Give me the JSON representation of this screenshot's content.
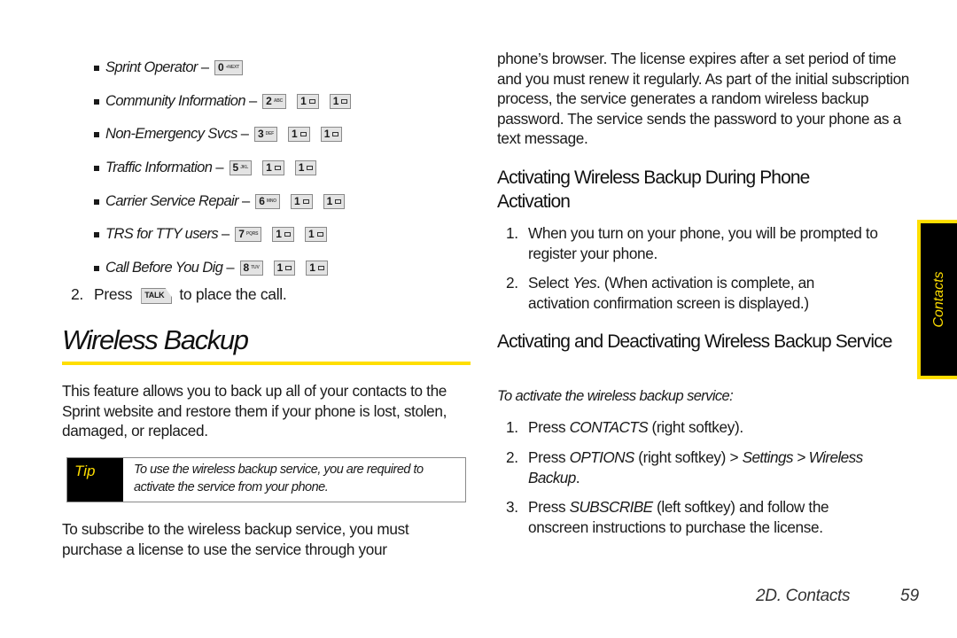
{
  "key_sequences": [
    {
      "label": "Sprint Operator",
      "keys": [
        {
          "num": "0",
          "sub": "+NEXT"
        }
      ]
    },
    {
      "label": "Community Information",
      "keys": [
        {
          "num": "2",
          "sub": "ABC"
        },
        {
          "num": "1",
          "sub": "mail"
        },
        {
          "num": "1",
          "sub": "mail"
        }
      ]
    },
    {
      "label": "Non-Emergency Svcs",
      "keys": [
        {
          "num": "3",
          "sub": "DEF"
        },
        {
          "num": "1",
          "sub": "mail"
        },
        {
          "num": "1",
          "sub": "mail"
        }
      ]
    },
    {
      "label": "Traffic Information",
      "keys": [
        {
          "num": "5",
          "sub": "JKL"
        },
        {
          "num": "1",
          "sub": "mail"
        },
        {
          "num": "1",
          "sub": "mail"
        }
      ]
    },
    {
      "label": "Carrier Service Repair",
      "keys": [
        {
          "num": "6",
          "sub": "MNO"
        },
        {
          "num": "1",
          "sub": "mail"
        },
        {
          "num": "1",
          "sub": "mail"
        }
      ]
    },
    {
      "label": "TRS for TTY users",
      "keys": [
        {
          "num": "7",
          "sub": "PQRS"
        },
        {
          "num": "1",
          "sub": "mail"
        },
        {
          "num": "1",
          "sub": "mail"
        }
      ]
    },
    {
      "label": "Call Before You Dig",
      "keys": [
        {
          "num": "8",
          "sub": "TUV"
        },
        {
          "num": "1",
          "sub": "mail"
        },
        {
          "num": "1",
          "sub": "mail"
        }
      ]
    }
  ],
  "dash": "–",
  "step2": {
    "num": "2.",
    "before": "Press",
    "key": "TALK",
    "after": "to place the call."
  },
  "section": {
    "title": "Wireless Backup",
    "intro": "This feature allows you to back up all of your contacts to the Sprint website and restore them if your phone is lost, stolen, damaged, or replaced.",
    "tip_label": "Tip",
    "tip_text": "To use the wireless backup service, you are required to activate the service from your phone.",
    "subscribe_para_start": "To subscribe to the wireless backup service, you must purchase a license to use the service through your",
    "subscribe_para_cont": "phone’s browser. The license expires after a set period of time and you must renew it regularly. As part of the initial subscription process, the service generates a random wireless backup password. The service sends the password to your phone as a text message."
  },
  "activation": {
    "heading": "Activating Wireless Backup During Phone Activation",
    "steps": [
      {
        "num": "1.",
        "text": "When you turn on your phone, you will be prompted to register your phone."
      },
      {
        "num": "2.",
        "pre": "Select ",
        "em": "Yes",
        "post": ". (When activation is complete, an activation confirmation screen is displayed.)"
      }
    ]
  },
  "service": {
    "heading": "Activating and Deactivating Wireless Backup Service",
    "intro": "To activate the wireless backup service:",
    "steps": [
      {
        "num": "1.",
        "pre": "Press ",
        "em": "CONTACTS",
        "post": " (right softkey)."
      },
      {
        "num": "2.",
        "pre": "Press ",
        "em": "OPTIONS",
        "mid": " (right softkey) > ",
        "em2": "Settings > Wireless Backup",
        "post": "."
      },
      {
        "num": "3.",
        "pre": "Press ",
        "em": "SUBSCRIBE",
        "post": " (left softkey) and follow the onscreen instructions to purchase the license."
      }
    ]
  },
  "side_tab": {
    "label": "Contacts"
  },
  "footer": {
    "section": "2D. Contacts",
    "page": "59"
  },
  "colors": {
    "accent_yellow": "#ffde00",
    "tab_bg": "#000000",
    "text": "#1a1a1a"
  }
}
